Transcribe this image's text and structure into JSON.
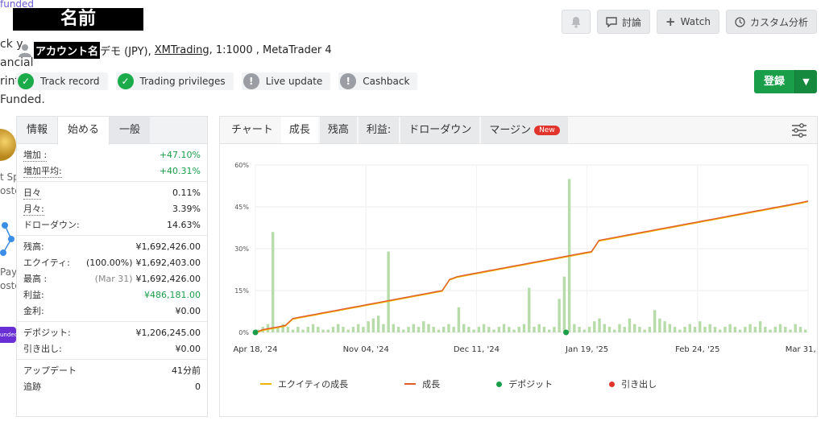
{
  "edge": {
    "top_label": "funded",
    "lines": [
      "ck y",
      "ancial",
      "rint",
      "Funded."
    ],
    "lower_lines": [
      "t Sp",
      "oste",
      "Pay",
      "oste"
    ],
    "purple_text": "unded"
  },
  "header": {
    "name_label": "名前",
    "account_name": "アカウント名",
    "account_type": "デモ (JPY),",
    "broker": "XMTrading",
    "leverage_platform": ", 1:1000 , MetaTrader 4"
  },
  "badges": [
    {
      "label": "Track record",
      "icon": "check-icon",
      "color": "#1bab4b"
    },
    {
      "label": "Trading privileges",
      "icon": "check-icon",
      "color": "#1bab4b"
    },
    {
      "label": "Live update",
      "icon": "exclamation-icon",
      "color": "#9a9da3"
    },
    {
      "label": "Cashback",
      "icon": "exclamation-icon",
      "color": "#9a9da3"
    }
  ],
  "toolbar": {
    "discuss": "討論",
    "watch": "Watch",
    "custom": "カスタム分析",
    "register": "登録"
  },
  "stats": {
    "tabs": [
      "情報",
      "始める",
      "一般"
    ],
    "groups": [
      [
        {
          "k": "増加 :",
          "v": "+47.10%",
          "green": true,
          "dotted": true
        },
        {
          "k": "増加平均:",
          "v": "+40.31%",
          "green": true,
          "dotted": true
        }
      ],
      [
        {
          "k": "日々",
          "v": "0.11%",
          "dotted": true
        },
        {
          "k": "月々:",
          "v": "3.39%",
          "dotted": true
        },
        {
          "k": "ドローダウン:",
          "v": "14.63%"
        }
      ],
      [
        {
          "k": "残高:",
          "v": "¥1,692,426.00"
        },
        {
          "k": "エクイティ:",
          "v": "¥1,692,403.00",
          "pre": "(100.00%)"
        },
        {
          "k": "最高 :",
          "v": "¥1,692,426.00",
          "pre": "(Mar 31)",
          "muted": true
        },
        {
          "k": "利益:",
          "v": "¥486,181.00",
          "green": true
        },
        {
          "k": "金利:",
          "v": "¥0.00"
        }
      ],
      [
        {
          "k": "デポジット:",
          "v": "¥1,206,245.00"
        },
        {
          "k": "引き出し:",
          "v": "¥0.00"
        }
      ],
      [
        {
          "k": "アップデート",
          "v": "41分前"
        },
        {
          "k": "追跡",
          "v": "0"
        }
      ]
    ]
  },
  "chart_tabs": [
    "チャート",
    "成長",
    "残高",
    "利益:",
    "ドローダウン",
    "マージン"
  ],
  "chart_new_badge": "New",
  "chart_data": {
    "type": "line",
    "y_ticks": [
      "0%",
      "15%",
      "30%",
      "45%",
      "60%"
    ],
    "x_ticks": [
      "Apr 18, '24",
      "Nov 04, '24",
      "Dec 11, '24",
      "Jan 19, '25",
      "Feb 24, '25",
      "Mar 31, '25"
    ],
    "ylim": [
      0,
      60
    ],
    "growth": [
      0,
      1,
      1.5,
      2,
      2.5,
      5,
      5.5,
      6,
      6.5,
      7,
      7.5,
      8,
      8.5,
      9,
      9.5,
      10,
      10.5,
      11,
      11.5,
      12,
      12.5,
      13,
      13.5,
      14,
      14.5,
      15,
      19,
      20,
      20.5,
      21,
      21.5,
      22,
      22.5,
      23,
      23.5,
      24,
      24.5,
      25,
      25.5,
      26,
      26.5,
      27,
      27.5,
      28,
      28.5,
      29,
      33,
      33.5,
      34,
      34.5,
      35,
      35.5,
      36,
      36.5,
      37,
      37.5,
      38,
      38.5,
      39,
      39.5,
      40,
      40.5,
      41,
      41.5,
      42,
      42.5,
      43,
      43.5,
      44,
      44.5,
      45,
      45.5,
      46,
      46.5,
      47.1
    ],
    "bars": [
      1,
      2,
      3,
      36,
      2,
      3,
      2,
      1,
      2,
      1,
      2,
      3,
      2,
      1,
      1,
      2,
      3,
      2,
      1,
      2,
      3,
      2,
      4,
      5,
      6,
      3,
      29,
      3,
      2,
      1,
      2,
      3,
      2,
      4,
      3,
      2,
      1,
      2,
      3,
      2,
      9,
      3,
      2,
      1,
      2,
      3,
      2,
      1,
      2,
      3,
      2,
      1,
      2,
      3,
      16,
      2,
      3,
      2,
      1,
      2,
      12,
      20,
      55,
      3,
      2,
      1,
      2,
      4,
      5,
      3,
      2,
      1,
      3,
      2,
      5,
      3,
      2,
      1,
      2,
      8,
      5,
      4,
      3,
      2,
      1,
      2,
      3,
      2,
      4,
      2,
      3,
      2,
      1,
      2,
      3,
      2,
      1,
      2,
      3,
      2,
      4,
      2,
      1,
      2,
      3,
      2,
      1,
      3,
      2,
      1
    ],
    "series": [
      {
        "name": "エクイティの成長",
        "color": "#f0b400"
      },
      {
        "name": "成長",
        "color": "#e05a2a"
      },
      {
        "name": "デポジット",
        "color": "#1a9e4a"
      },
      {
        "name": "引き出し",
        "color": "#e0342c"
      }
    ]
  }
}
